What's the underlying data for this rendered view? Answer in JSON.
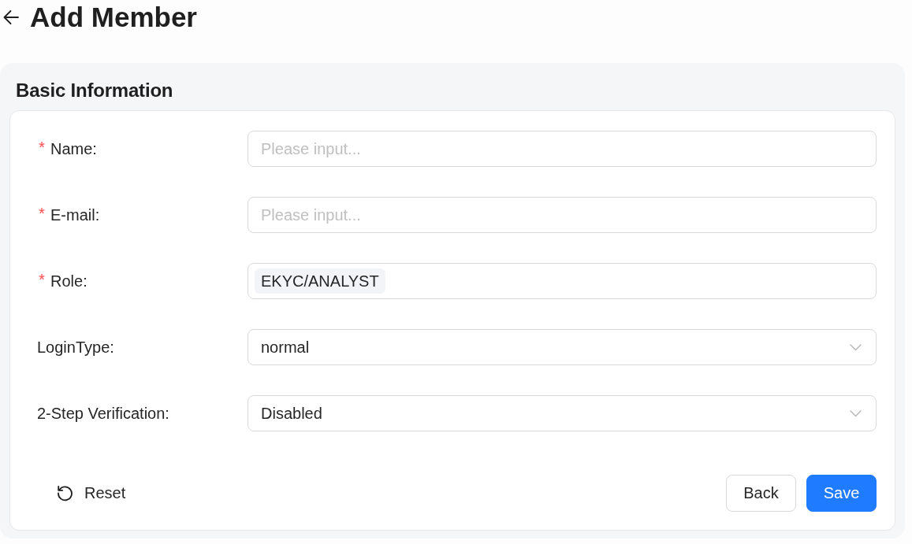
{
  "header": {
    "title": "Add Member"
  },
  "section": {
    "title": "Basic Information"
  },
  "fields": [
    {
      "kind": "text",
      "required_mark": "*",
      "label": "Name:",
      "placeholder": "Please input..."
    },
    {
      "kind": "text",
      "required_mark": "*",
      "label": "E-mail:",
      "placeholder": "Please input..."
    },
    {
      "kind": "tags",
      "required_mark": "*",
      "label": "Role:",
      "tags": [
        "EKYC/ANALYST"
      ]
    },
    {
      "kind": "select",
      "label": "LoginType:",
      "value": "normal"
    },
    {
      "kind": "select",
      "label": "2-Step Verification:",
      "value": "Disabled"
    }
  ],
  "footer": {
    "reset": {
      "label": "Reset"
    },
    "buttons": [
      {
        "kind": "default",
        "label": "Back"
      },
      {
        "kind": "primary",
        "label": "Save"
      }
    ]
  }
}
